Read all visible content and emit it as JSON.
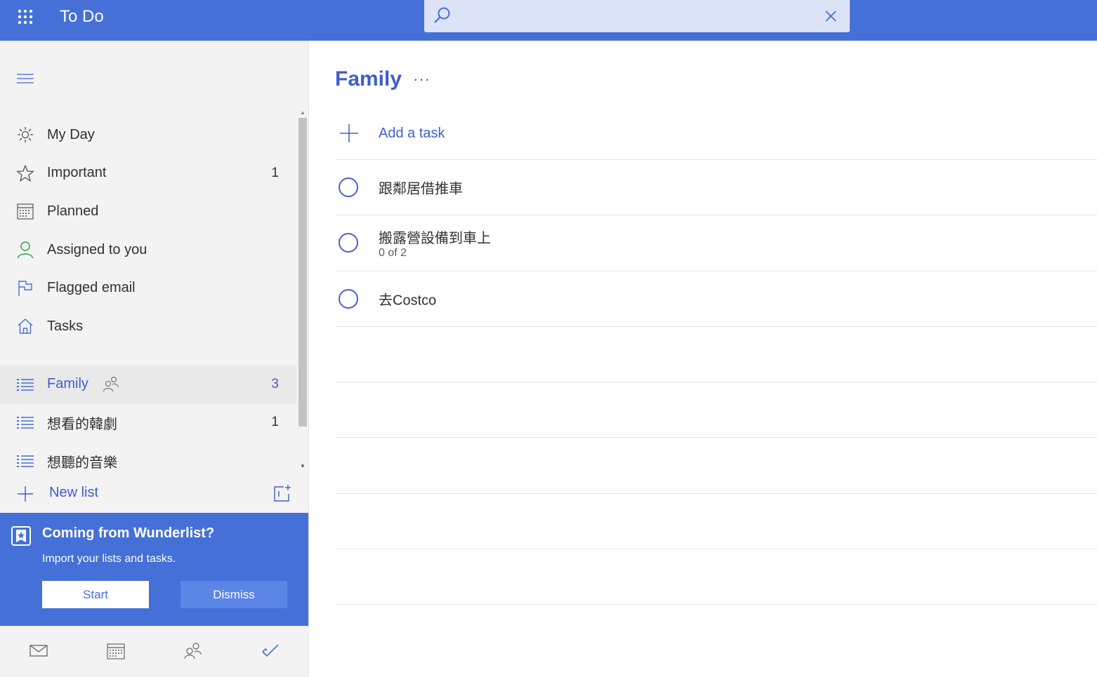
{
  "header": {
    "app_title": "To Do",
    "search": {
      "placeholder": "",
      "value": ""
    }
  },
  "sidebar": {
    "nav": [
      {
        "label": "My Day",
        "count": "",
        "icon": "sun-icon"
      },
      {
        "label": "Important",
        "count": "1",
        "icon": "star-icon"
      },
      {
        "label": "Planned",
        "count": "",
        "icon": "calendar-icon"
      },
      {
        "label": "Assigned to you",
        "count": "",
        "icon": "person-icon"
      },
      {
        "label": "Flagged email",
        "count": "",
        "icon": "flag-icon"
      },
      {
        "label": "Tasks",
        "count": "",
        "icon": "home-icon"
      }
    ],
    "lists": [
      {
        "label": "Family",
        "count": "3",
        "active": true,
        "shared": true
      },
      {
        "label": "想看的韓劇",
        "count": "1",
        "active": false,
        "shared": false
      },
      {
        "label": "想聽的音樂",
        "count": "",
        "active": false,
        "shared": false
      }
    ],
    "new_list_label": "New list"
  },
  "banner": {
    "title": "Coming from Wunderlist?",
    "subtitle": "Import your lists and tasks.",
    "start_label": "Start",
    "dismiss_label": "Dismiss"
  },
  "switcher": [
    "mail-icon",
    "calendar-icon",
    "people-icon",
    "todo-check-icon"
  ],
  "main": {
    "list_title": "Family",
    "more_label": "···",
    "add_task_label": "Add a task",
    "tasks": [
      {
        "title": "跟鄰居借推車",
        "meta": ""
      },
      {
        "title": "搬露營設備到車上",
        "meta": "0 of 2"
      },
      {
        "title": "去Costco",
        "meta": ""
      }
    ]
  },
  "colors": {
    "accent": "#4470d8",
    "accent_text": "#3f5dcc",
    "sidebar_bg": "#f3f3f3"
  }
}
